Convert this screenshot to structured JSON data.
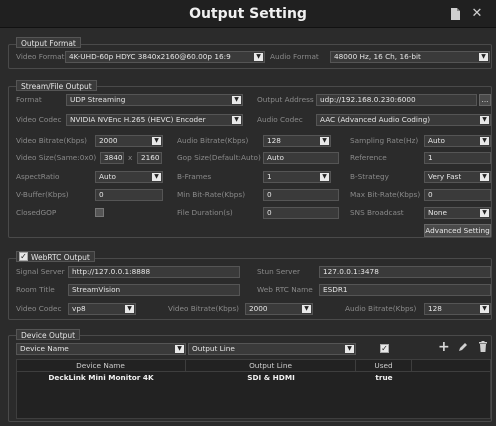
{
  "window": {
    "title": "Output Setting",
    "doc_icon": "document-icon",
    "close_icon": "close-icon"
  },
  "output_format": {
    "group_title": "Output Format",
    "video_format_label": "Video Format",
    "video_format_value": "4K-UHD-60p HDYC 3840x2160@60.00p 16:9",
    "audio_format_label": "Audio Format",
    "audio_format_value": "48000 Hz, 16 Ch, 16-bit"
  },
  "stream": {
    "group_title": "Stream/File Output",
    "format_label": "Format",
    "format_value": "UDP Streaming",
    "output_address_label": "Output Address",
    "output_address_value": "udp://192.168.0.230:6000",
    "browse_label": "...",
    "video_codec_label": "Video Codec",
    "video_codec_value": "NVIDIA NVEnc H.265 (HEVC) Encoder",
    "audio_codec_label": "Audio Codec",
    "audio_codec_value": "AAC (Advanced Audio Coding)",
    "video_bitrate_label": "Video Bitrate(Kbps)",
    "video_bitrate_value": "2000",
    "audio_bitrate_label": "Audio Bitrate(Kbps)",
    "audio_bitrate_value": "128",
    "sampling_rate_label": "Sampling Rate(Hz)",
    "sampling_rate_value": "Auto",
    "video_size_label": "Video Size(Same:0x0)",
    "video_width": "3840",
    "video_x": "x",
    "video_height": "2160",
    "gop_size_label": "Gop Size(Default:Auto)",
    "gop_size_value": "Auto",
    "reference_label": "Reference",
    "reference_value": "1",
    "aspect_ratio_label": "AspectRatio",
    "aspect_ratio_value": "Auto",
    "bframes_label": "B-Frames",
    "bframes_value": "1",
    "bstrategy_label": "B-Strategy",
    "bstrategy_value": "Very Fast",
    "vbuffer_label": "V-Buffer(Kbps)",
    "vbuffer_value": "0",
    "min_bitrate_label": "Min Bit-Rate(Kbps)",
    "min_bitrate_value": "0",
    "max_bitrate_label": "Max Bit-Rate(Kbps)",
    "max_bitrate_value": "0",
    "closed_gop_label": "ClosedGOP",
    "file_duration_label": "File Duration(s)",
    "file_duration_value": "0",
    "sns_broadcast_label": "SNS Broadcast",
    "sns_broadcast_value": "None",
    "advanced_label": "Advanced Setting"
  },
  "webrtc": {
    "group_title": "WebRTC Output",
    "enabled": true,
    "signal_server_label": "Signal Server",
    "signal_server_value": "http://127.0.0.1:8888",
    "stun_server_label": "Stun Server",
    "stun_server_value": "127.0.0.1:3478",
    "room_title_label": "Room Title",
    "room_title_value": "StreamVision",
    "rtc_name_label": "Web RTC Name",
    "rtc_name_value": "ESDR1",
    "video_codec_label": "Video Codec",
    "video_codec_value": "vp8",
    "video_bitrate_label": "Video Bitrate(Kbps)",
    "video_bitrate_value": "2000",
    "audio_bitrate_label": "Audio Bitrate(Kbps)",
    "audio_bitrate_value": "128"
  },
  "device": {
    "group_title": "Device Output",
    "device_name_select": "Device Name",
    "output_line_select": "Output Line",
    "columns": [
      "Device Name",
      "Output Line",
      "Used"
    ],
    "rows": [
      {
        "name": "DeckLink Mini Monitor 4K",
        "line": "SDI & HDMI",
        "used": "true"
      }
    ]
  },
  "colors": {
    "background": "#2b2b2b",
    "titlebar": "#202020",
    "field": "#3a3a3a"
  }
}
